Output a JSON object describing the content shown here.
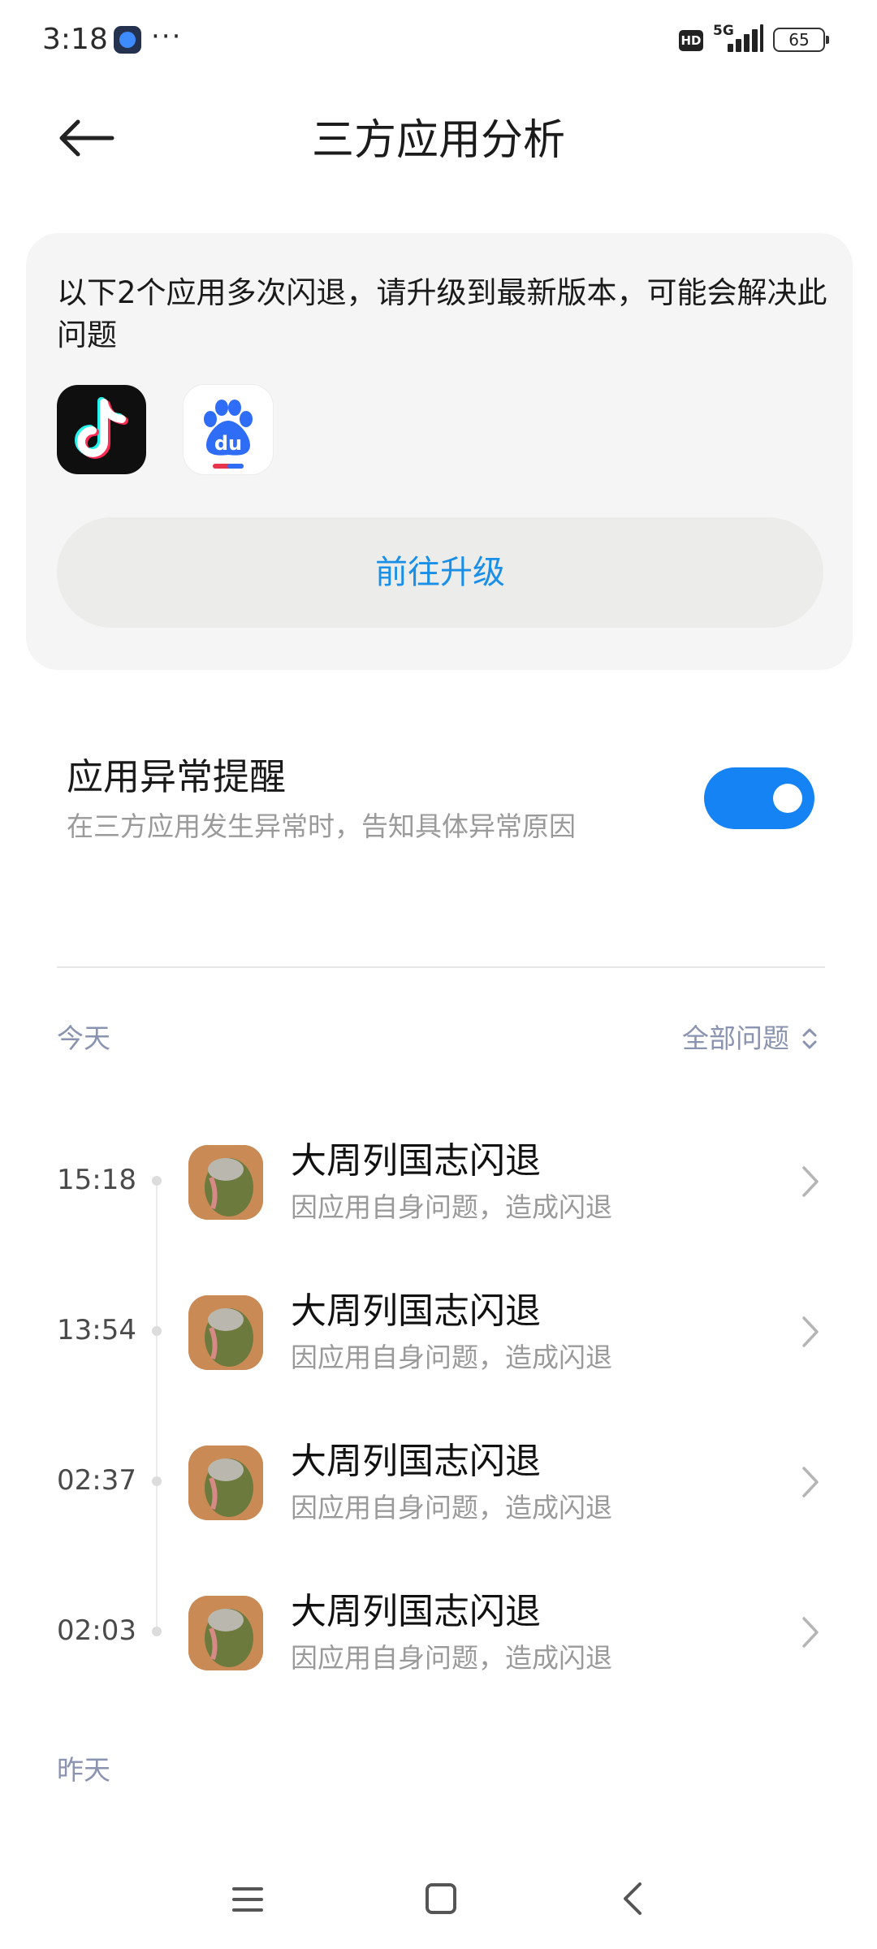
{
  "status_bar": {
    "time": "3:18",
    "more": "···",
    "hd": "HD",
    "network": "5G",
    "battery": "65"
  },
  "header": {
    "title": "三方应用分析"
  },
  "crash_card": {
    "message": "以下2个应用多次闪退，请升级到最新版本，可能会解决此问题",
    "apps": [
      {
        "name": "tiktok-icon"
      },
      {
        "name": "baidu-icon"
      }
    ],
    "upgrade_label": "前往升级"
  },
  "reminder": {
    "title": "应用异常提醒",
    "description": "在三方应用发生异常时，告知具体异常原因",
    "enabled": true
  },
  "history": {
    "today_label": "今天",
    "filter_label": "全部问题",
    "items": [
      {
        "time": "15:18",
        "title": "大周列国志闪退",
        "subtitle": "因应用自身问题，造成闪退"
      },
      {
        "time": "13:54",
        "title": "大周列国志闪退",
        "subtitle": "因应用自身问题，造成闪退"
      },
      {
        "time": "02:37",
        "title": "大周列国志闪退",
        "subtitle": "因应用自身问题，造成闪退"
      },
      {
        "time": "02:03",
        "title": "大周列国志闪退",
        "subtitle": "因应用自身问题，造成闪退"
      }
    ],
    "yesterday_label": "昨天"
  },
  "colors": {
    "accent": "#1683f4",
    "link": "#1a8fe8",
    "section_label": "#8a93b0"
  }
}
